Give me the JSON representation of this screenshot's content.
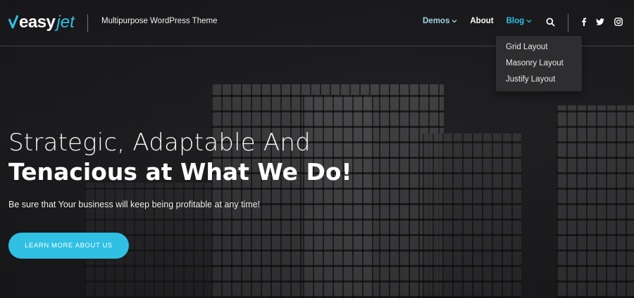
{
  "header": {
    "logo": {
      "part1": "easy",
      "part2": "jet"
    },
    "tagline": "Multipurpose WordPress Theme",
    "nav": {
      "demos": "Demos",
      "about": "About",
      "blog": "Blog"
    },
    "icons": {
      "search": "search-icon",
      "facebook": "facebook-icon",
      "twitter": "twitter-icon",
      "instagram": "instagram-icon"
    }
  },
  "blog_dropdown": {
    "items": [
      "Grid Layout",
      "Masonry Layout",
      "Justify Layout"
    ]
  },
  "hero": {
    "headline_light": "Strategic, Adaptable And",
    "headline_bold": "Tenacious at What We Do!",
    "subheadline": "Be sure that Your business will keep being profitable at any time!",
    "cta_label": "LEARN MORE ABOUT US"
  },
  "colors": {
    "accent": "#2fc0e3",
    "demos_link": "#9fd3e6",
    "background": "#1c1c1e",
    "dropdown_bg": "#2e2e30"
  }
}
